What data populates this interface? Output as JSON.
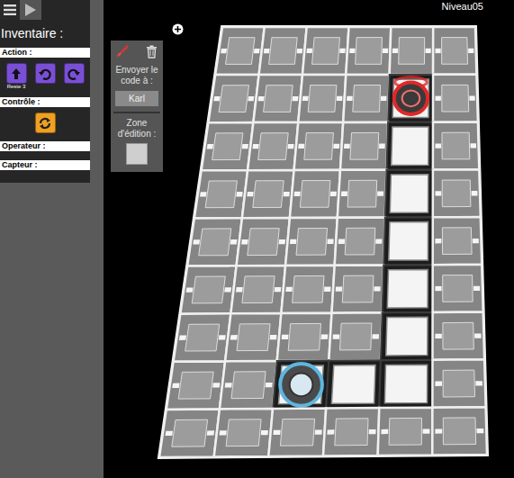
{
  "level": "Niveau05",
  "inventory": {
    "title": "Inventaire :",
    "sections": [
      {
        "label": "Action :",
        "color": "#7a4fd6",
        "blocks": [
          {
            "kind": "forward",
            "note": "Reste 3"
          },
          {
            "kind": "turn-left"
          },
          {
            "kind": "turn-right"
          }
        ]
      },
      {
        "label": "Contrôle :",
        "color": "#f0a020",
        "blocks": [
          {
            "kind": "loop"
          }
        ]
      },
      {
        "label": "Operateur :",
        "color": "#4a90d9",
        "blocks": []
      },
      {
        "label": "Capteur :",
        "color": "#3aa65a",
        "blocks": []
      }
    ]
  },
  "editor": {
    "send_label": "Envoyer le code à :",
    "recipient": "Karl",
    "zone_label": "Zone d'édition :"
  },
  "board": {
    "rows": [
      [
        "floor",
        "floor",
        "floor",
        "floor",
        "floor",
        "floor"
      ],
      [
        "floor",
        "floor",
        "floor",
        "floor",
        "target",
        "floor"
      ],
      [
        "floor",
        "floor",
        "floor",
        "floor",
        "path",
        "floor"
      ],
      [
        "floor",
        "floor",
        "floor",
        "floor",
        "path",
        "floor"
      ],
      [
        "floor",
        "floor",
        "floor",
        "floor",
        "path",
        "floor"
      ],
      [
        "floor",
        "floor",
        "floor",
        "floor",
        "path",
        "floor"
      ],
      [
        "floor",
        "floor",
        "floor",
        "floor",
        "path",
        "floor"
      ],
      [
        "floor",
        "floor",
        "robot",
        "path",
        "path",
        "floor"
      ],
      [
        "floor",
        "floor",
        "floor",
        "floor",
        "floor",
        "floor"
      ]
    ]
  }
}
